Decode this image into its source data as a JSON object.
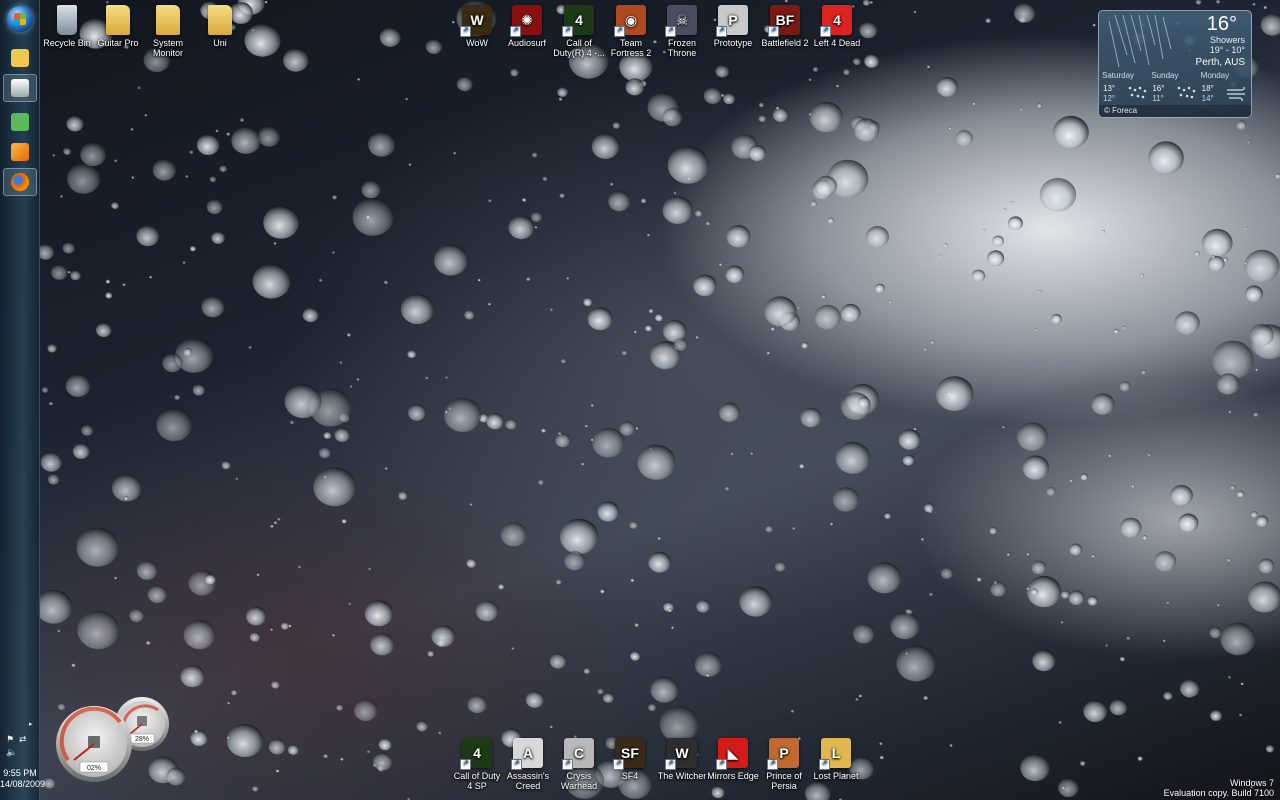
{
  "desktop_icons_left": [
    {
      "id": "recycle-bin",
      "label": "Recycle Bin",
      "icon": "recycle-bin-icon",
      "color": "#9aa6b2",
      "shortcut": false
    },
    {
      "id": "guitar-pro",
      "label": "Guitar Pro",
      "icon": "folder-icon",
      "color": "#e8c65a",
      "shortcut": false
    },
    {
      "id": "system-monitor",
      "label": "System Monitor",
      "icon": "folder-icon",
      "color": "#e8c65a",
      "shortcut": false
    },
    {
      "id": "uni",
      "label": "Uni",
      "icon": "folder-icon",
      "color": "#e8c65a",
      "shortcut": false
    }
  ],
  "desktop_icons_top": [
    {
      "id": "wow",
      "label": "WoW",
      "icon": "wow-icon",
      "glyph": "W",
      "color": "#3a2a10",
      "shortcut": true
    },
    {
      "id": "audiosurf",
      "label": "Audiosurf",
      "icon": "audiosurf-icon",
      "glyph": "✺",
      "color": "#8a1010",
      "shortcut": true
    },
    {
      "id": "cod4",
      "label": "Call of Duty(R) 4 -...",
      "icon": "call-of-duty-icon",
      "glyph": "4",
      "color": "#1c3a16",
      "shortcut": true
    },
    {
      "id": "tf2",
      "label": "Team Fortress 2",
      "icon": "team-fortress-icon",
      "glyph": "◉",
      "color": "#b0491d",
      "shortcut": true
    },
    {
      "id": "frozen-throne",
      "label": "Frozen Throne",
      "icon": "frozen-throne-icon",
      "glyph": "☠",
      "color": "#4a4e60",
      "shortcut": true
    },
    {
      "id": "prototype",
      "label": "Prototype",
      "icon": "prototype-icon",
      "glyph": "P",
      "color": "#c9c9c9",
      "shortcut": true
    },
    {
      "id": "battlefield2",
      "label": "Battlefield 2",
      "icon": "battlefield-icon",
      "glyph": "BF",
      "color": "#7a1a12",
      "shortcut": true
    },
    {
      "id": "l4d",
      "label": "Left 4 Dead",
      "icon": "left-4-dead-icon",
      "glyph": "4",
      "color": "#d22",
      "shortcut": true
    }
  ],
  "desktop_icons_bottom": [
    {
      "id": "cod4sp",
      "label": "Call of Duty 4 SP",
      "icon": "call-of-duty-icon",
      "glyph": "4",
      "color": "#1c3a16",
      "shortcut": true
    },
    {
      "id": "assassins-creed",
      "label": "Assassin's Creed",
      "icon": "assassins-creed-icon",
      "glyph": "A",
      "color": "#d8d8d8",
      "shortcut": true
    },
    {
      "id": "crysis",
      "label": "Crysis Warhead",
      "icon": "crysis-icon",
      "glyph": "C",
      "color": "#b8b8b8",
      "shortcut": true
    },
    {
      "id": "sf4",
      "label": "SF4",
      "icon": "street-fighter-icon",
      "glyph": "SF",
      "color": "#3a2a1a",
      "shortcut": true
    },
    {
      "id": "witcher",
      "label": "The Witcher",
      "icon": "witcher-icon",
      "glyph": "W",
      "color": "#2e2e2e",
      "shortcut": true
    },
    {
      "id": "mirrors-edge",
      "label": "Mirrors Edge",
      "icon": "mirrors-edge-icon",
      "glyph": "◣",
      "color": "#d51a1a",
      "shortcut": true
    },
    {
      "id": "prince-of-persia",
      "label": "Prince of Persia",
      "icon": "prince-of-persia-icon",
      "glyph": "P",
      "color": "#c06a30",
      "shortcut": true
    },
    {
      "id": "lost-planet",
      "label": "Lost Planet",
      "icon": "lost-planet-icon",
      "glyph": "L",
      "color": "#e0b850",
      "shortcut": true
    }
  ],
  "taskbar": {
    "items": [
      {
        "name": "explorer",
        "icon": "folder-icon",
        "color": "#f0c850",
        "active": false
      },
      {
        "name": "switcher",
        "icon": "switch-windows-icon",
        "color": "#e8e8e8",
        "active": true
      },
      {
        "name": "messenger",
        "icon": "messenger-icon",
        "color": "#5cb85c",
        "active": false
      },
      {
        "name": "media-player",
        "icon": "media-player-icon",
        "color": "#f08a24",
        "active": false
      },
      {
        "name": "firefox",
        "icon": "firefox-icon",
        "color": "#e66000",
        "active": true
      }
    ],
    "clock_time": "9:55 PM",
    "clock_date": "14/08/2009"
  },
  "weather": {
    "temp": "16°",
    "condition": "Showers",
    "range": "19° - 10°",
    "location": "Perth, AUS",
    "forecast": [
      {
        "day": "Saturday",
        "high": "13°",
        "low": "12°"
      },
      {
        "day": "Sunday",
        "high": "16°",
        "low": "11°"
      },
      {
        "day": "Monday",
        "high": "18°",
        "low": "14°"
      }
    ],
    "footer": "© Foreca"
  },
  "meter": {
    "cpu": "02%",
    "memory": "28%"
  },
  "watermark": {
    "line1": "Windows 7",
    "line2": "Evaluation copy. Build 7100"
  }
}
